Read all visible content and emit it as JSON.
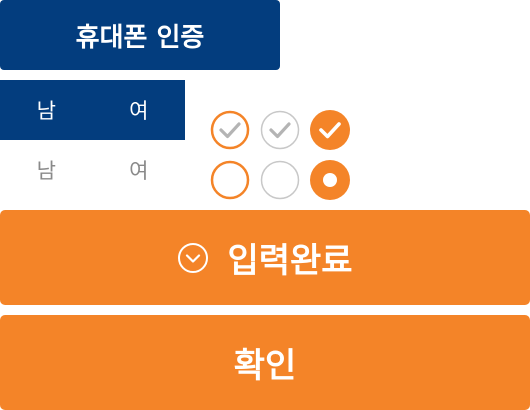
{
  "phone_auth": {
    "label": "휴대폰 인증"
  },
  "gender_selected": {
    "male": "남",
    "female": "여"
  },
  "gender_default": {
    "male": "남",
    "female": "여"
  },
  "checkboxes": [
    {
      "icon": "check-icon",
      "state": "outlined-orange"
    },
    {
      "icon": "check-icon",
      "state": "outlined-gray"
    },
    {
      "icon": "check-icon",
      "state": "filled-orange"
    }
  ],
  "radios": [
    {
      "icon": "radio-icon",
      "state": "outlined-orange"
    },
    {
      "icon": "radio-icon",
      "state": "outlined-gray"
    },
    {
      "icon": "radio-icon",
      "state": "filled-orange"
    }
  ],
  "complete_button": {
    "label": "입력완료",
    "icon": "chevron-down-circle-icon"
  },
  "confirm_button": {
    "label": "확인"
  },
  "colors": {
    "navy": "#033d7e",
    "orange": "#f48428",
    "gray": "#c8c8c8"
  }
}
